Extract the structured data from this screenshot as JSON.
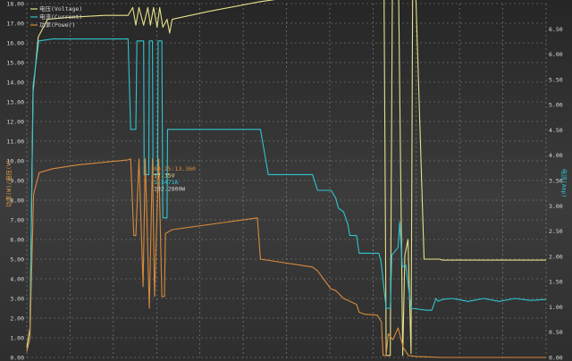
{
  "chart_data": {
    "type": "line",
    "title": "",
    "xlabel": "",
    "ylabel_left": "功率(W)/电压(V)",
    "ylabel_right": "电流(Amp)",
    "y_left_range": [
      0,
      18
    ],
    "y_right_range": [
      0,
      7
    ],
    "y_left_ticks": [
      "0.00",
      "1.00",
      "2.00",
      "3.00",
      "4.00",
      "5.00",
      "6.00",
      "7.00",
      "8.00",
      "9.00",
      "10.00",
      "11.00",
      "12.00",
      "13.00",
      "14.00",
      "15.00",
      "16.00",
      "17.00",
      "18.00"
    ],
    "y_right_ticks": [
      "0.00",
      "0.50",
      "1.00",
      "1.50",
      "2.00",
      "2.50",
      "3.00",
      "3.50",
      "4.00",
      "4.50",
      "5.00",
      "5.50",
      "6.00",
      "6.50"
    ],
    "x_range": [
      0,
      100
    ],
    "grid": true,
    "legend_position": "top-left",
    "legend": [
      {
        "name": "电压(Voltage)",
        "color": "#e6e08a"
      },
      {
        "name": "电流(Current)",
        "color": "#2ec5cf"
      },
      {
        "name": "功率(Power)",
        "color": "#d88a3c"
      }
    ],
    "annotation": {
      "lines": [
        "00:25:13.360",
        "17.35V",
        "5.3471A",
        "102.2800W"
      ],
      "colors": [
        "#d88a3c",
        "#e6e08a",
        "#2ec5cf",
        "#d0d0d0"
      ]
    },
    "series": [
      {
        "name": "电压(Voltage)",
        "axis": "left",
        "color": "#e6e08a",
        "x": [
          0,
          0.6,
          1.2,
          2.2,
          4,
          8,
          15,
          17,
          19.5,
          20.4,
          21,
          21.6,
          22.5,
          23.3,
          23.8,
          24.4,
          25.1,
          25.6,
          26.2,
          27,
          27.5,
          28,
          35,
          45,
          53,
          57,
          62,
          63.5,
          64.5,
          66,
          67.5,
          68.2,
          68.8,
          69.2,
          70,
          70.4,
          70.9,
          71.6,
          72.4,
          72.8,
          73.4,
          74,
          74.3,
          74.9,
          76.5,
          79.5,
          80,
          100
        ],
        "y": [
          0.5,
          1.5,
          13.5,
          16.3,
          17.2,
          17.3,
          17.4,
          17.4,
          17.4,
          17.8,
          16.9,
          17.8,
          16.9,
          17.8,
          16.9,
          17.8,
          16.8,
          17.8,
          16.8,
          17.2,
          16.5,
          17.2,
          17.6,
          18.1,
          18.4,
          18.6,
          18.6,
          18.7,
          18.6,
          18.6,
          18.6,
          18.5,
          18.6,
          0.1,
          0.1,
          18.5,
          18.4,
          18.6,
          0.1,
          5.2,
          6.0,
          0.2,
          18.5,
          18.5,
          5.0,
          5.0,
          4.95,
          4.95
        ]
      },
      {
        "name": "电流(Current)",
        "axis": "left",
        "color": "#2ec5cf",
        "x": [
          0,
          0.6,
          1.2,
          2.3,
          5,
          19.5,
          20,
          21,
          21.2,
          22.5,
          22.6,
          23.5,
          23.6,
          24.2,
          24.3,
          25.2,
          25.3,
          26,
          26.2,
          27,
          27.1,
          28,
          45,
          46.5,
          55,
          56,
          58.6,
          59.5,
          60,
          61,
          61.8,
          62.2,
          63.5,
          64,
          65.7,
          67.8,
          68.2,
          69.2,
          70,
          70.3,
          71.5,
          71.8,
          72.3,
          73,
          74,
          77,
          78,
          78.8,
          79.2,
          80,
          82,
          85,
          88,
          91,
          94,
          97,
          100
        ],
        "y": [
          0.3,
          1,
          13.8,
          16.1,
          16.2,
          16.2,
          11.6,
          11.6,
          16.1,
          16.1,
          9.3,
          9.3,
          16.1,
          16.1,
          9.3,
          9.3,
          16.1,
          16.1,
          7.1,
          7.1,
          11.6,
          11.6,
          11.6,
          9.3,
          9.3,
          8.5,
          8.5,
          8.1,
          7.6,
          7.4,
          6.8,
          6.2,
          6.2,
          5.3,
          5.3,
          5.3,
          4.9,
          2.5,
          2.5,
          5.2,
          5.6,
          6.9,
          4.6,
          4.7,
          2.5,
          2.4,
          2.4,
          3.0,
          2.85,
          2.95,
          3.0,
          2.85,
          3.0,
          2.85,
          3.0,
          2.9,
          2.95
        ]
      },
      {
        "name": "功率(Power)",
        "axis": "left",
        "color": "#d88a3c",
        "x": [
          0,
          0.6,
          1.3,
          2.4,
          5,
          10,
          19.5,
          20,
          20.6,
          21,
          21.6,
          22.4,
          22.8,
          23.6,
          24.2,
          24.6,
          25.4,
          26,
          26.5,
          26.7,
          28,
          44.4,
          45,
          55,
          56,
          58.5,
          59.5,
          61,
          63.5,
          64,
          65,
          67.5,
          68.3,
          68.6,
          69.2,
          69.6,
          70.5,
          71.5,
          72.5,
          73.5,
          75,
          80,
          100
        ],
        "y": [
          0.3,
          1,
          8.3,
          9.4,
          9.6,
          9.8,
          10.05,
          10.1,
          6.2,
          6.2,
          10.1,
          3.6,
          10.1,
          2.5,
          10.1,
          3.1,
          10.1,
          3.1,
          3.1,
          6.3,
          6.5,
          7.1,
          5.0,
          4.6,
          4.4,
          3.5,
          3.4,
          3.0,
          2.7,
          2.3,
          2.2,
          2.15,
          1.8,
          0.1,
          0.1,
          1.2,
          0.9,
          1.5,
          0.5,
          0.1,
          0.05,
          0.0,
          0.0
        ]
      }
    ]
  }
}
